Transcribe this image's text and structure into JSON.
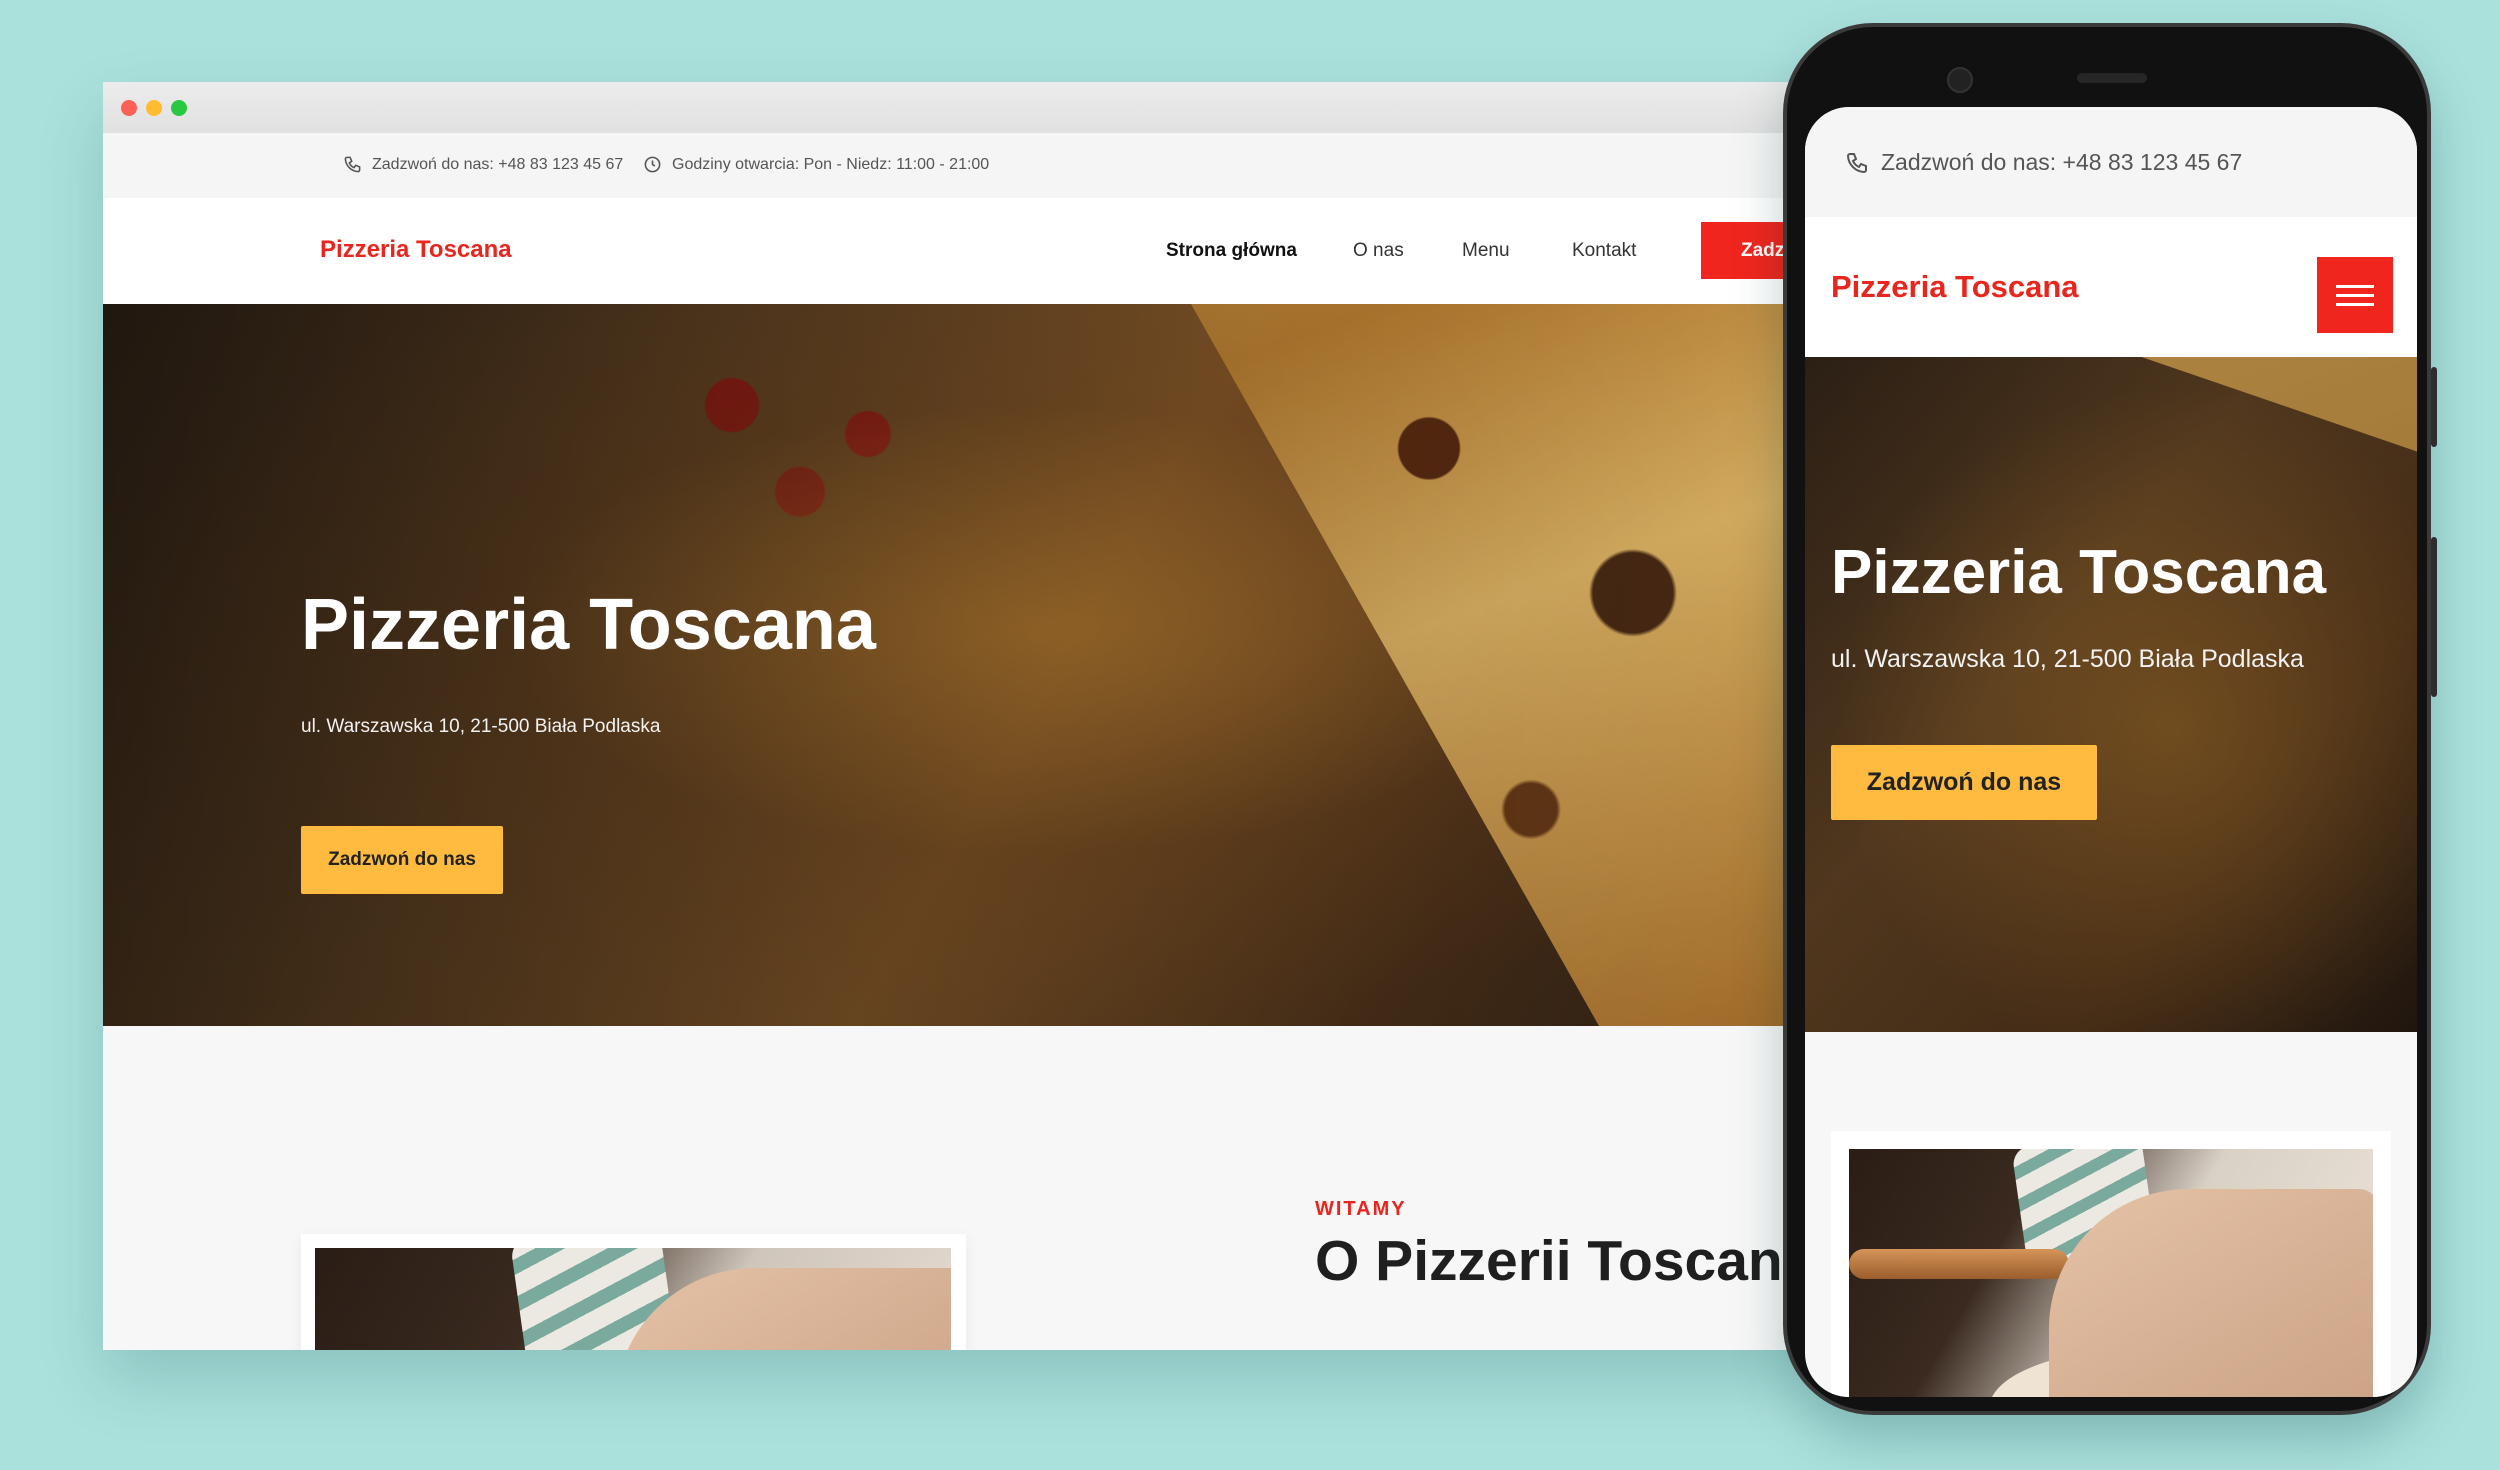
{
  "desktop": {
    "topbar": {
      "phone_text": "Zadzwoń do nas: +48 83 123 45 67",
      "hours_text": "Godziny otwarcia: Pon - Niedz: 11:00 - 21:00"
    },
    "navbar": {
      "brand": "Pizzeria Toscana",
      "items": [
        {
          "label": "Strona główna",
          "active": true
        },
        {
          "label": "O nas"
        },
        {
          "label": "Menu"
        },
        {
          "label": "Kontakt"
        }
      ],
      "cta_label": "Zadz"
    },
    "hero": {
      "title": "Pizzeria Toscana",
      "address": "ul. Warszawska 10, 21-500 Biała Podlaska",
      "button": "Zadzwoń do nas"
    },
    "about": {
      "kicker": "WITAMY",
      "title": "O Pizzerii Toscana"
    }
  },
  "mobile": {
    "topbar": {
      "phone_text": "Zadzwoń do nas: +48 83 123 45 67"
    },
    "navbar": {
      "brand": "Pizzeria Toscana"
    },
    "hero": {
      "title": "Pizzeria Toscana",
      "address": "ul. Warszawska 10, 21-500 Biała Podlaska",
      "button": "Zadzwoń do nas"
    }
  },
  "colors": {
    "background": "#abe1dd",
    "brand_red": "#f0261e",
    "cta_yellow": "#ffbb3f"
  },
  "icons": {
    "phone": "phone-icon",
    "clock": "clock-icon",
    "menu": "hamburger-menu-icon"
  }
}
